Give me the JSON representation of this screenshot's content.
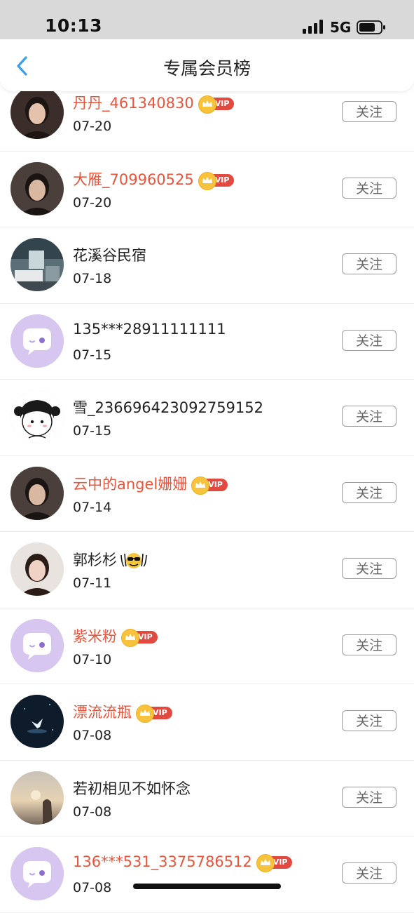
{
  "status_bar": {
    "time": "10:13",
    "network": "5G"
  },
  "header": {
    "title": "专属会员榜",
    "back_icon": "chevron-left-icon"
  },
  "vip_label": "VIP",
  "colors": {
    "vip_name": "#e8553a",
    "vip_badge": "#e24a40",
    "back_arrow": "#3a9ee8",
    "default_avatar": "#d6c6f0"
  },
  "members": [
    {
      "name": "丹丹_461340830",
      "date": "07-20",
      "vip": true,
      "follow_label": "关注",
      "avatar": "photo-avatar"
    },
    {
      "name": "大雁_709960525",
      "date": "07-20",
      "vip": true,
      "follow_label": "关注",
      "avatar": "photo-avatar"
    },
    {
      "name": "花溪谷民宿",
      "date": "07-18",
      "vip": false,
      "follow_label": "关注",
      "avatar": "room-photo-avatar"
    },
    {
      "name": "135***28911111111",
      "date": "07-15",
      "vip": false,
      "follow_label": "关注",
      "avatar": "default-chat-avatar"
    },
    {
      "name": "雪_236696423092759152",
      "date": "07-15",
      "vip": false,
      "follow_label": "关注",
      "avatar": "cartoon-girl-avatar"
    },
    {
      "name": "云中的angel姗姗",
      "date": "07-14",
      "vip": true,
      "follow_label": "关注",
      "avatar": "photo-avatar"
    },
    {
      "name": "郭杉杉",
      "date": "07-11",
      "vip": false,
      "follow_label": "关注",
      "avatar": "photo-avatar",
      "name_emoji": "sunglasses-emoji-icon"
    },
    {
      "name": "紫米粉",
      "date": "07-10",
      "vip": true,
      "follow_label": "关注",
      "avatar": "default-chat-avatar"
    },
    {
      "name": "漂流流瓶",
      "date": "07-08",
      "vip": true,
      "follow_label": "关注",
      "avatar": "night-flower-avatar"
    },
    {
      "name": "若初相见不如怀念",
      "date": "07-08",
      "vip": false,
      "follow_label": "关注",
      "avatar": "sunset-photo-avatar"
    },
    {
      "name": "136***531_3375786512",
      "date": "07-08",
      "vip": true,
      "follow_label": "关注",
      "avatar": "default-chat-avatar"
    }
  ]
}
